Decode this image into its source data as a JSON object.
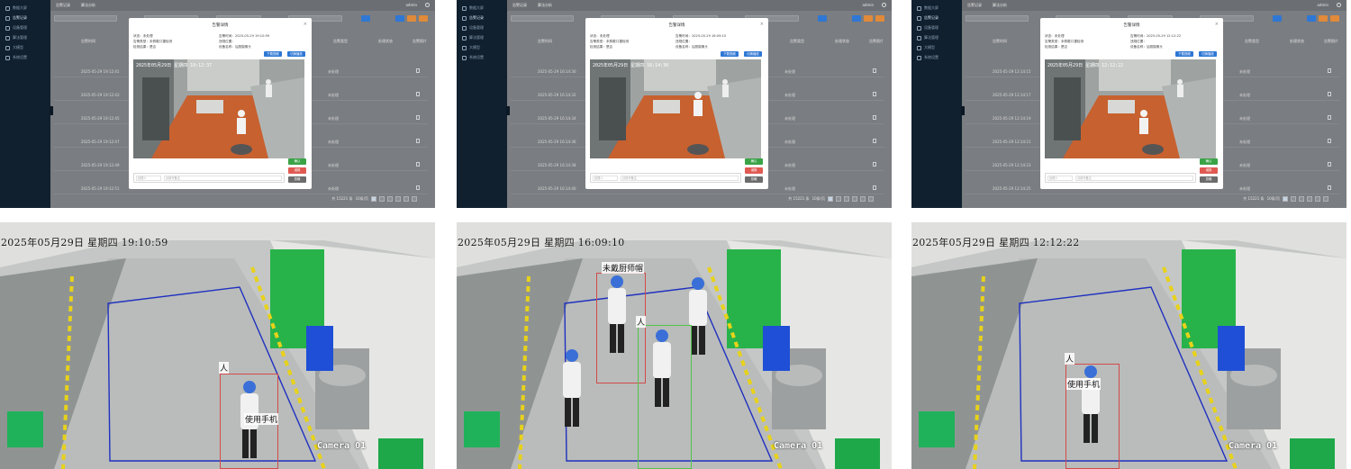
{
  "colors": {
    "sidebar": "#10202f",
    "primary": "#2f77d4",
    "success": "#3aa347",
    "danger": "#e05a52",
    "neutral": "#6c6c6c",
    "zone": "#2030c0",
    "alarm_box": "#d24a4a",
    "ok_box": "#52c44a"
  },
  "app": {
    "sidebar": [
      "数据大屏",
      "告警记录",
      "设备管理",
      "算法管理",
      "大模型",
      "系统设置"
    ],
    "tabs": [
      "告警记录",
      "算法分析"
    ],
    "user": "admin",
    "table_headers": [
      "告警时间",
      "告警类型",
      "处理状态",
      "告警照片"
    ],
    "row_status": "未处理",
    "pager_total": "共 15221 条",
    "pager_size": "10条/页",
    "pager_pages": [
      "1",
      "2",
      "3",
      "4",
      "5",
      "6"
    ]
  },
  "screens": [
    {
      "modal": {
        "title": "告警详情",
        "status": "状态：未处理",
        "type": "告警类型：未佩戴口罩检测",
        "algo": "告警时间：2025-05-29 19:10:59",
        "pos": "违规位置：",
        "device": "设备名称：后厨摄像头",
        "result": "检测结果：是否",
        "btn_download": "下载视频",
        "btn_dl_photo": "切换播放",
        "timestamp": "2025年05月29日 星期四 19:12:37",
        "remark_hint": "处理人",
        "remark_text": "请填写备注",
        "act_ok": "确认",
        "act_false": "误报",
        "act_ignore": "忽略"
      },
      "rows": [
        "2025-05-29 19:12:41",
        "2025-05-29 19:12:43",
        "2025-05-29 19:12:45",
        "2025-05-29 19:12:47",
        "2025-05-29 19:12:49",
        "2025-05-29 19:12:51"
      ]
    },
    {
      "modal": {
        "title": "告警详情",
        "status": "状态：未处理",
        "type": "告警类型：未佩戴口罩检测",
        "algo": "告警时间：2025-05-29 16:09:10",
        "pos": "违规位置：",
        "device": "设备名称：后厨摄像头",
        "result": "检测结果：是否",
        "btn_download": "下载视频",
        "btn_dl_photo": "切换播放",
        "timestamp": "2025年05月29日 星期四 16:14:30",
        "remark_hint": "处理人",
        "remark_text": "请填写备注",
        "act_ok": "确认",
        "act_false": "误报",
        "act_ignore": "忽略"
      },
      "rows": [
        "2025-05-29 16:14:30",
        "2025-05-29 16:14:32",
        "2025-05-29 16:14:34",
        "2025-05-29 16:14:36",
        "2025-05-29 16:14:38",
        "2025-05-29 16:14:40"
      ]
    },
    {
      "modal": {
        "title": "告警详情",
        "status": "状态：未处理",
        "type": "告警类型：未佩戴口罩检测",
        "algo": "告警时间：2025-05-29 12:12:22",
        "pos": "违规位置：",
        "device": "设备名称：后厨摄像头",
        "result": "检测结果：是否",
        "btn_download": "下载视频",
        "btn_dl_photo": "切换播放",
        "timestamp": "2025年05月29日 星期四 12:12:22",
        "remark_hint": "处理人",
        "remark_text": "请填写备注",
        "act_ok": "确认",
        "act_false": "误报",
        "act_ignore": "忽略"
      },
      "rows": [
        "2025-05-29 12:14:15",
        "2025-05-29 12:14:17",
        "2025-05-29 12:14:19",
        "2025-05-29 12:14:21",
        "2025-05-29 12:14:23",
        "2025-05-29 12:14:25"
      ]
    }
  ],
  "cameras": [
    {
      "time": "2025年05月29日 星期四 19:10:59",
      "label": "Camera 01",
      "tags": [
        "人",
        "使用手机"
      ]
    },
    {
      "time": "2025年05月29日 星期四 16:09:10",
      "label": "Camera 01",
      "tags": [
        "未戴厨师帽",
        "人"
      ]
    },
    {
      "time": "2025年05月29日 星期四 12:12:22",
      "label": "Camera 01",
      "tags": [
        "人",
        "使用手机"
      ]
    }
  ]
}
